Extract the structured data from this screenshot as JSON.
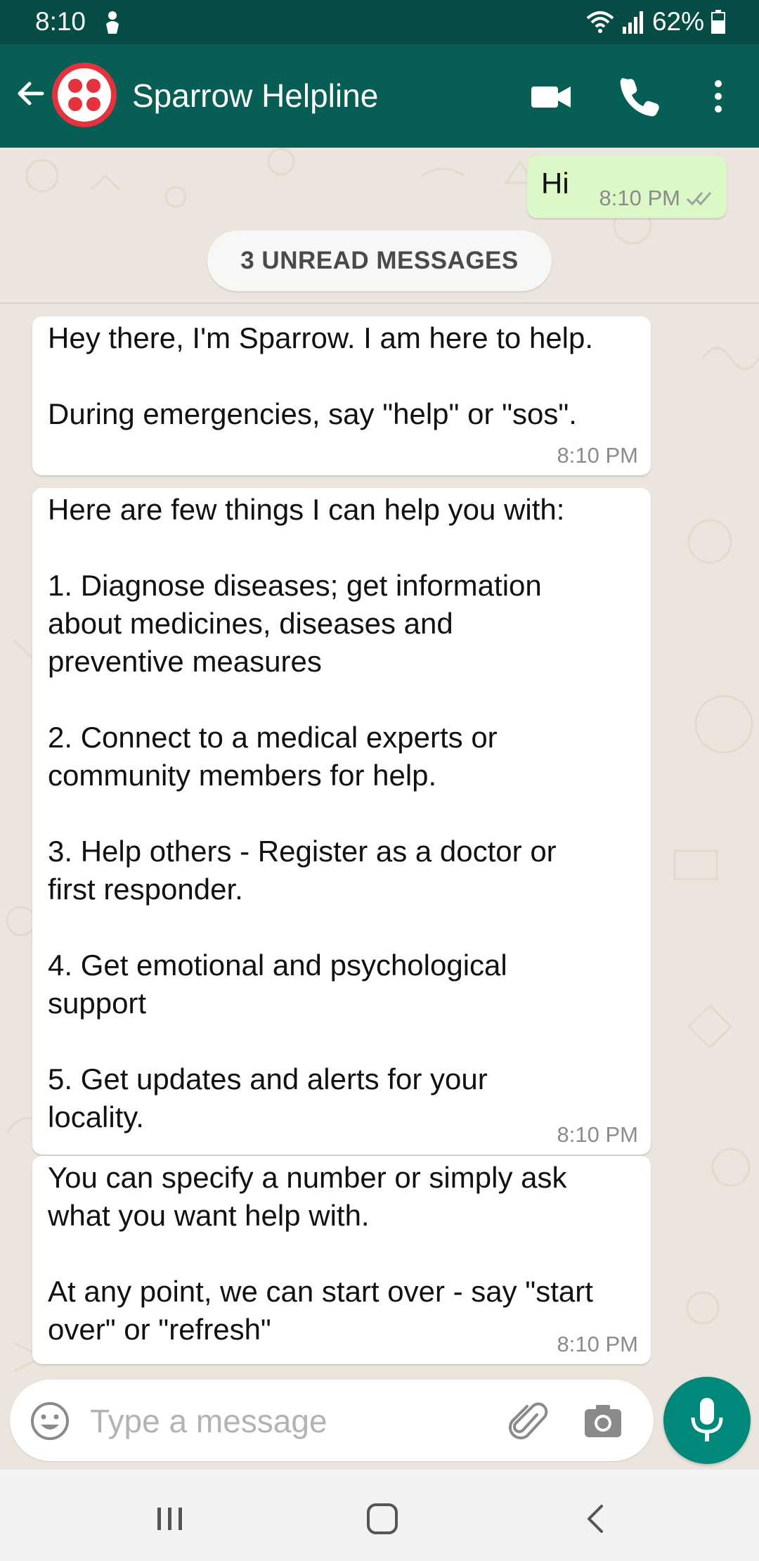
{
  "status_bar": {
    "time": "8:10",
    "battery": "62%"
  },
  "header": {
    "title": "Sparrow Helpline"
  },
  "messages": [
    {
      "direction": "out",
      "text": "Hi",
      "time": "8:10 PM",
      "status": "read"
    },
    {
      "direction": "in",
      "text": "Hey there, I'm Sparrow. I am here to help.\n\nDuring emergencies, say \"help\" or \"sos\".",
      "time": "8:10 PM"
    },
    {
      "direction": "in",
      "text": "Here are few things I can help you with:\n\n1. Diagnose diseases; get information\nabout medicines, diseases and\npreventive measures\n\n2. Connect to a medical experts or\ncommunity members for help.\n\n3. Help others - Register as a doctor or\nfirst responder.\n\n4. Get emotional and psychological\nsupport\n\n5. Get updates and alerts for your\nlocality.",
      "time": "8:10 PM"
    },
    {
      "direction": "in",
      "text": "You can specify a number or simply ask\nwhat you want help with.\n\nAt any point, we can start over - say \"start\nover\" or \"refresh\"",
      "time": "8:10 PM"
    }
  ],
  "unread_banner": "3 UNREAD MESSAGES",
  "composer": {
    "placeholder": "Type a message"
  },
  "colors": {
    "header": "#075e54",
    "status_bar": "#054d44",
    "outgoing_bubble": "#dcf8c6",
    "incoming_bubble": "#ffffff",
    "mic_button": "#00897b",
    "avatar": "#e5323e"
  },
  "icons": [
    "back-arrow-icon",
    "video-call-icon",
    "voice-call-icon",
    "more-options-icon",
    "emoji-icon",
    "attach-icon",
    "camera-icon",
    "mic-icon",
    "recent-apps-icon",
    "home-icon",
    "nav-back-icon",
    "read-receipt-icon",
    "wifi-icon",
    "signal-icon",
    "battery-icon"
  ]
}
